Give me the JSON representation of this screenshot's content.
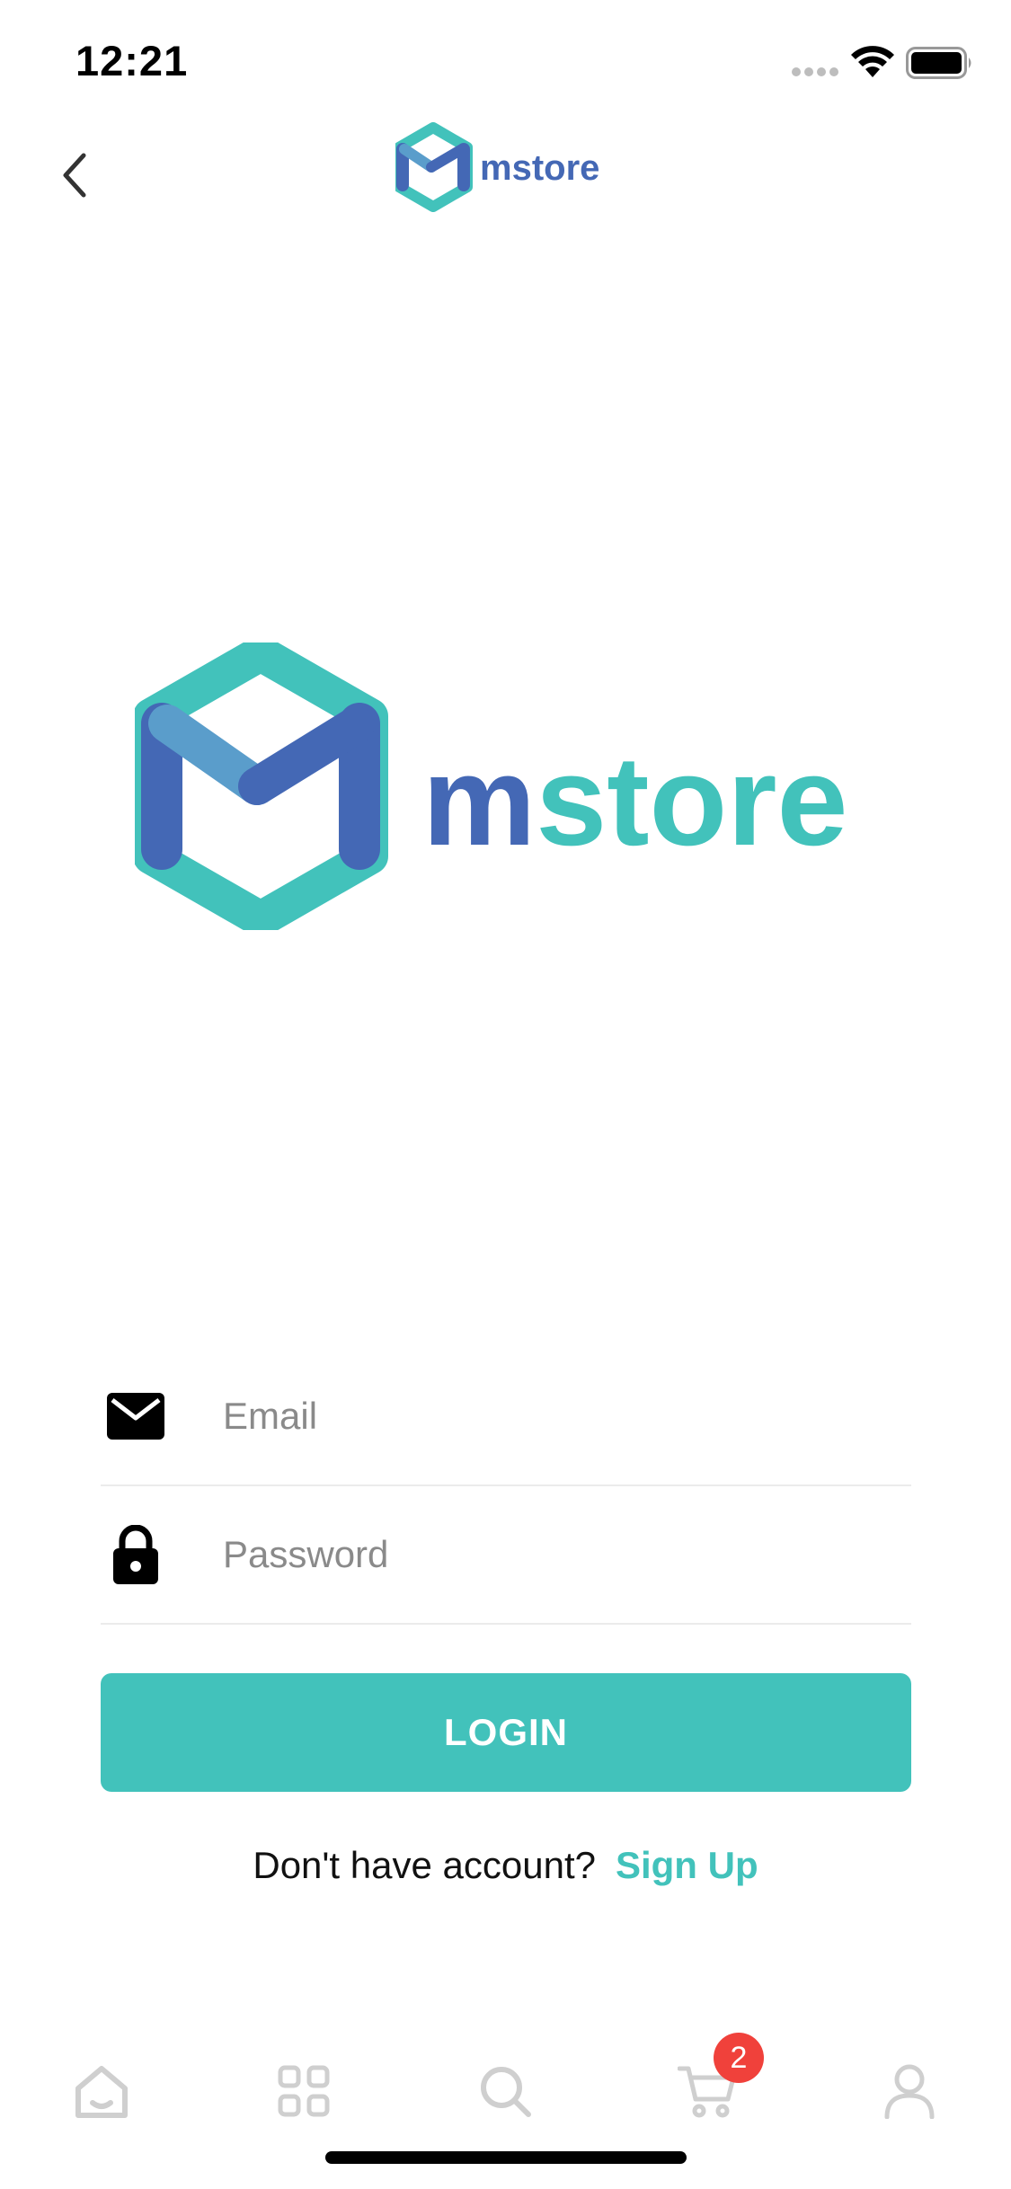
{
  "status_bar": {
    "time": "12:21"
  },
  "nav": {
    "back_icon": "chevron-left-icon",
    "logo_text": "mstore"
  },
  "hero": {
    "logo_text": "mstore"
  },
  "brand_colors": {
    "teal": "#42c2bb",
    "blue": "#4468b5",
    "light_blue": "#5a9dcb"
  },
  "form": {
    "email": {
      "icon": "envelope-icon",
      "placeholder": "Email",
      "value": ""
    },
    "password": {
      "icon": "lock-icon",
      "placeholder": "Password",
      "value": ""
    },
    "login_label": "LOGIN",
    "signup_prompt": "Don't have account?",
    "signup_link": "Sign Up"
  },
  "tab_bar": {
    "tabs": [
      {
        "icon": "home-icon"
      },
      {
        "icon": "grid-icon"
      },
      {
        "icon": "search-icon"
      },
      {
        "icon": "cart-icon",
        "badge": "2"
      },
      {
        "icon": "user-icon"
      }
    ]
  }
}
